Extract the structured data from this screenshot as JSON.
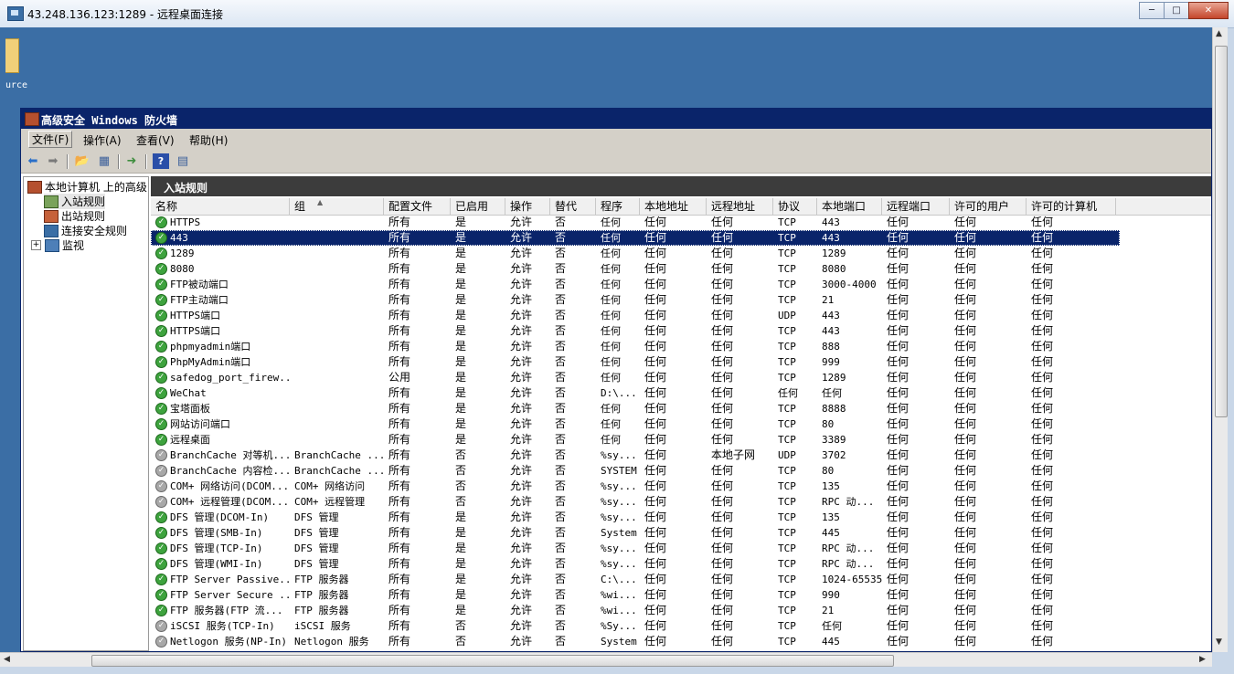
{
  "rdp": {
    "title": "43.248.136.123:1289 - 远程桌面连接",
    "desktop_label": "urce"
  },
  "fw": {
    "title": "高级安全 Windows 防火墙",
    "menu": [
      "文件(F)",
      "操作(A)",
      "查看(V)",
      "帮助(H)"
    ],
    "tree": {
      "root": "本地计算机 上的高级",
      "items": [
        "入站规则",
        "出站规则",
        "连接安全规则",
        "监视"
      ]
    },
    "panel_title": "入站规则",
    "columns": [
      "名称",
      "组",
      "配置文件",
      "已启用",
      "操作",
      "替代",
      "程序",
      "本地地址",
      "远程地址",
      "协议",
      "本地端口",
      "远程端口",
      "许可的用户",
      "许可的计算机"
    ],
    "rows": [
      {
        "enabled_icon": "on",
        "cells": [
          "HTTPS",
          "",
          "所有",
          "是",
          "允许",
          "否",
          "任何",
          "任何",
          "任何",
          "TCP",
          "443",
          "任何",
          "任何",
          "任何"
        ]
      },
      {
        "enabled_icon": "on",
        "selected": true,
        "cells": [
          "443",
          "",
          "所有",
          "是",
          "允许",
          "否",
          "任何",
          "任何",
          "任何",
          "TCP",
          "443",
          "任何",
          "任何",
          "任何"
        ]
      },
      {
        "enabled_icon": "on",
        "cells": [
          "1289",
          "",
          "所有",
          "是",
          "允许",
          "否",
          "任何",
          "任何",
          "任何",
          "TCP",
          "1289",
          "任何",
          "任何",
          "任何"
        ]
      },
      {
        "enabled_icon": "on",
        "cells": [
          "8080",
          "",
          "所有",
          "是",
          "允许",
          "否",
          "任何",
          "任何",
          "任何",
          "TCP",
          "8080",
          "任何",
          "任何",
          "任何"
        ]
      },
      {
        "enabled_icon": "on",
        "cells": [
          "FTP被动端口",
          "",
          "所有",
          "是",
          "允许",
          "否",
          "任何",
          "任何",
          "任何",
          "TCP",
          "3000-4000",
          "任何",
          "任何",
          "任何"
        ]
      },
      {
        "enabled_icon": "on",
        "cells": [
          "FTP主动端口",
          "",
          "所有",
          "是",
          "允许",
          "否",
          "任何",
          "任何",
          "任何",
          "TCP",
          "21",
          "任何",
          "任何",
          "任何"
        ]
      },
      {
        "enabled_icon": "on",
        "cells": [
          "HTTPS端口",
          "",
          "所有",
          "是",
          "允许",
          "否",
          "任何",
          "任何",
          "任何",
          "UDP",
          "443",
          "任何",
          "任何",
          "任何"
        ]
      },
      {
        "enabled_icon": "on",
        "cells": [
          "HTTPS端口",
          "",
          "所有",
          "是",
          "允许",
          "否",
          "任何",
          "任何",
          "任何",
          "TCP",
          "443",
          "任何",
          "任何",
          "任何"
        ]
      },
      {
        "enabled_icon": "on",
        "cells": [
          "phpmyadmin端口",
          "",
          "所有",
          "是",
          "允许",
          "否",
          "任何",
          "任何",
          "任何",
          "TCP",
          "888",
          "任何",
          "任何",
          "任何"
        ]
      },
      {
        "enabled_icon": "on",
        "cells": [
          "PhpMyAdmin端口",
          "",
          "所有",
          "是",
          "允许",
          "否",
          "任何",
          "任何",
          "任何",
          "TCP",
          "999",
          "任何",
          "任何",
          "任何"
        ]
      },
      {
        "enabled_icon": "on",
        "cells": [
          "safedog_port_firew...",
          "",
          "公用",
          "是",
          "允许",
          "否",
          "任何",
          "任何",
          "任何",
          "TCP",
          "1289",
          "任何",
          "任何",
          "任何"
        ]
      },
      {
        "enabled_icon": "on",
        "cells": [
          "WeChat",
          "",
          "所有",
          "是",
          "允许",
          "否",
          "D:\\...",
          "任何",
          "任何",
          "任何",
          "任何",
          "任何",
          "任何",
          "任何"
        ]
      },
      {
        "enabled_icon": "on",
        "cells": [
          "宝塔面板",
          "",
          "所有",
          "是",
          "允许",
          "否",
          "任何",
          "任何",
          "任何",
          "TCP",
          "8888",
          "任何",
          "任何",
          "任何"
        ]
      },
      {
        "enabled_icon": "on",
        "cells": [
          "网站访问端口",
          "",
          "所有",
          "是",
          "允许",
          "否",
          "任何",
          "任何",
          "任何",
          "TCP",
          "80",
          "任何",
          "任何",
          "任何"
        ]
      },
      {
        "enabled_icon": "on",
        "cells": [
          "远程桌面",
          "",
          "所有",
          "是",
          "允许",
          "否",
          "任何",
          "任何",
          "任何",
          "TCP",
          "3389",
          "任何",
          "任何",
          "任何"
        ]
      },
      {
        "enabled_icon": "off",
        "cells": [
          "BranchCache 对等机...",
          "BranchCache ...",
          "所有",
          "否",
          "允许",
          "否",
          "%sy...",
          "任何",
          "本地子网",
          "UDP",
          "3702",
          "任何",
          "任何",
          "任何"
        ]
      },
      {
        "enabled_icon": "off",
        "cells": [
          "BranchCache 内容检...",
          "BranchCache ...",
          "所有",
          "否",
          "允许",
          "否",
          "SYSTEM",
          "任何",
          "任何",
          "TCP",
          "80",
          "任何",
          "任何",
          "任何"
        ]
      },
      {
        "enabled_icon": "off",
        "cells": [
          "COM+ 网络访问(DCOM...",
          "COM+ 网络访问",
          "所有",
          "否",
          "允许",
          "否",
          "%sy...",
          "任何",
          "任何",
          "TCP",
          "135",
          "任何",
          "任何",
          "任何"
        ]
      },
      {
        "enabled_icon": "off",
        "cells": [
          "COM+ 远程管理(DCOM...",
          "COM+ 远程管理",
          "所有",
          "否",
          "允许",
          "否",
          "%sy...",
          "任何",
          "任何",
          "TCP",
          "RPC 动...",
          "任何",
          "任何",
          "任何"
        ]
      },
      {
        "enabled_icon": "on",
        "cells": [
          "DFS 管理(DCOM-In)",
          "DFS 管理",
          "所有",
          "是",
          "允许",
          "否",
          "%sy...",
          "任何",
          "任何",
          "TCP",
          "135",
          "任何",
          "任何",
          "任何"
        ]
      },
      {
        "enabled_icon": "on",
        "cells": [
          "DFS 管理(SMB-In)",
          "DFS 管理",
          "所有",
          "是",
          "允许",
          "否",
          "System",
          "任何",
          "任何",
          "TCP",
          "445",
          "任何",
          "任何",
          "任何"
        ]
      },
      {
        "enabled_icon": "on",
        "cells": [
          "DFS 管理(TCP-In)",
          "DFS 管理",
          "所有",
          "是",
          "允许",
          "否",
          "%sy...",
          "任何",
          "任何",
          "TCP",
          "RPC 动...",
          "任何",
          "任何",
          "任何"
        ]
      },
      {
        "enabled_icon": "on",
        "cells": [
          "DFS 管理(WMI-In)",
          "DFS 管理",
          "所有",
          "是",
          "允许",
          "否",
          "%sy...",
          "任何",
          "任何",
          "TCP",
          "RPC 动...",
          "任何",
          "任何",
          "任何"
        ]
      },
      {
        "enabled_icon": "on",
        "cells": [
          "FTP Server Passive...",
          "FTP 服务器",
          "所有",
          "是",
          "允许",
          "否",
          "C:\\...",
          "任何",
          "任何",
          "TCP",
          "1024-65535",
          "任何",
          "任何",
          "任何"
        ]
      },
      {
        "enabled_icon": "on",
        "cells": [
          "FTP Server Secure ...",
          "FTP 服务器",
          "所有",
          "是",
          "允许",
          "否",
          "%wi...",
          "任何",
          "任何",
          "TCP",
          "990",
          "任何",
          "任何",
          "任何"
        ]
      },
      {
        "enabled_icon": "on",
        "cells": [
          "FTP 服务器(FTP 流...",
          "FTP 服务器",
          "所有",
          "是",
          "允许",
          "否",
          "%wi...",
          "任何",
          "任何",
          "TCP",
          "21",
          "任何",
          "任何",
          "任何"
        ]
      },
      {
        "enabled_icon": "off",
        "cells": [
          "iSCSI 服务(TCP-In)",
          "iSCSI 服务",
          "所有",
          "否",
          "允许",
          "否",
          "%Sy...",
          "任何",
          "任何",
          "TCP",
          "任何",
          "任何",
          "任何",
          "任何"
        ]
      },
      {
        "enabled_icon": "off",
        "cells": [
          "Netlogon 服务(NP-In)",
          "Netlogon 服务",
          "所有",
          "否",
          "允许",
          "否",
          "System",
          "任何",
          "任何",
          "TCP",
          "445",
          "任何",
          "任何",
          "任何"
        ]
      }
    ]
  }
}
